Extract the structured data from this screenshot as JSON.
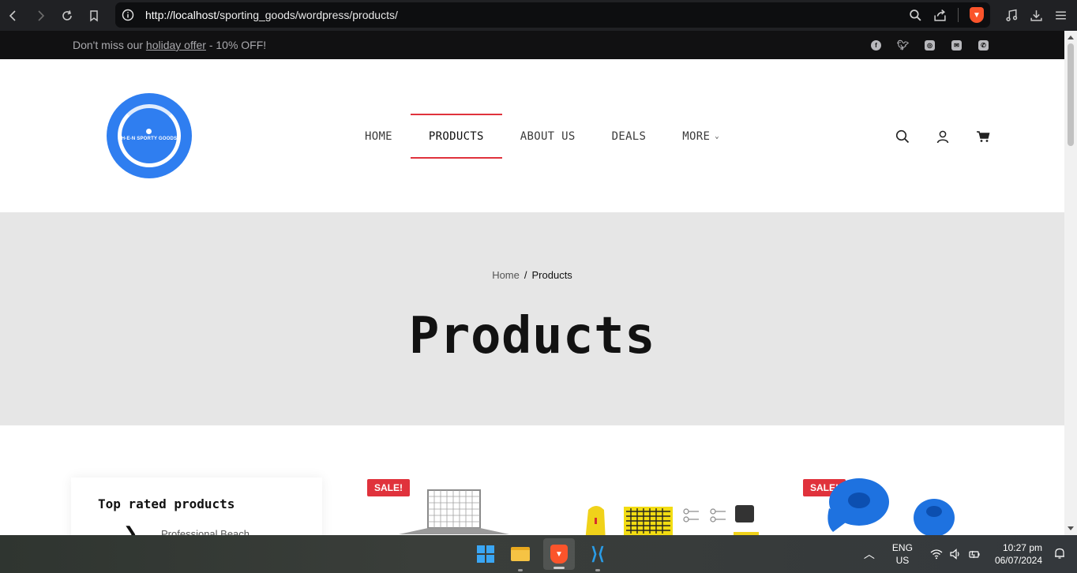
{
  "browser": {
    "url_host": "http://localhost",
    "url_path": "/sporting_goods/wordpress/products/"
  },
  "topbar": {
    "promo_prefix": "Don't miss our ",
    "promo_link": "holiday offer",
    "promo_suffix": " - 10% OFF!"
  },
  "header": {
    "logo_text": "H-E-N SPORTY GOODS",
    "menu": [
      {
        "label": "HOME"
      },
      {
        "label": "PRODUCTS"
      },
      {
        "label": "ABOUT US"
      },
      {
        "label": "DEALS"
      },
      {
        "label": "MORE"
      }
    ]
  },
  "hero": {
    "breadcrumb_home": "Home",
    "breadcrumb_sep": "/",
    "breadcrumb_current": "Products",
    "title": "Products"
  },
  "sidebar": {
    "heading": "Top rated products",
    "first_item": "Professional Beach"
  },
  "products": {
    "badge_1": "SALE!",
    "badge_2": "SALE!"
  },
  "taskbar": {
    "lang_1": "ENG",
    "lang_2": "US",
    "time": "10:27 pm",
    "date": "06/07/2024"
  },
  "colors": {
    "accent": "#e0323c",
    "logo_blue": "#2f7ef0",
    "hero_bg": "#e6e6e6",
    "topbar_bg": "#111112"
  }
}
